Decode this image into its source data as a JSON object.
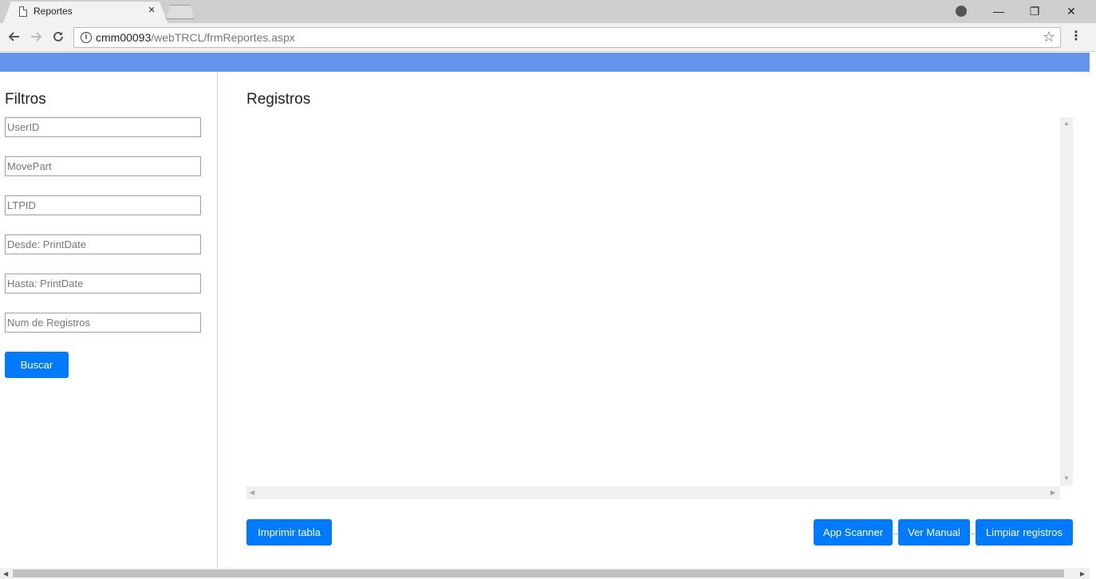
{
  "browser": {
    "tab_title": "Reportes",
    "tab_close": "×",
    "url_host": "cmm00093",
    "url_path": "/webTRCL/frmReportes.aspx",
    "window_controls": {
      "minimize": "—",
      "restore": "❐",
      "close": "✕"
    },
    "icons": [
      "page-icon",
      "account-icon",
      "back-arrow-icon",
      "forward-arrow-icon",
      "reload-icon",
      "info-icon",
      "star-icon",
      "menu-icon"
    ]
  },
  "colors": {
    "top_bar": "#6495ed",
    "button": "#007bff"
  },
  "sidebar": {
    "title": "Filtros",
    "filters": [
      {
        "placeholder": "UserID"
      },
      {
        "placeholder": "MovePart"
      },
      {
        "placeholder": "LTPID"
      },
      {
        "placeholder": "Desde: PrintDate"
      },
      {
        "placeholder": "Hasta: PrintDate"
      },
      {
        "placeholder": "Num de Registros"
      }
    ],
    "search_button": "Buscar"
  },
  "main": {
    "title": "Registros",
    "buttons": {
      "print": "Imprimir tabla",
      "app_scanner": "App Scanner",
      "manual": "Ver Manual",
      "clear": "Limpiar registros"
    }
  }
}
